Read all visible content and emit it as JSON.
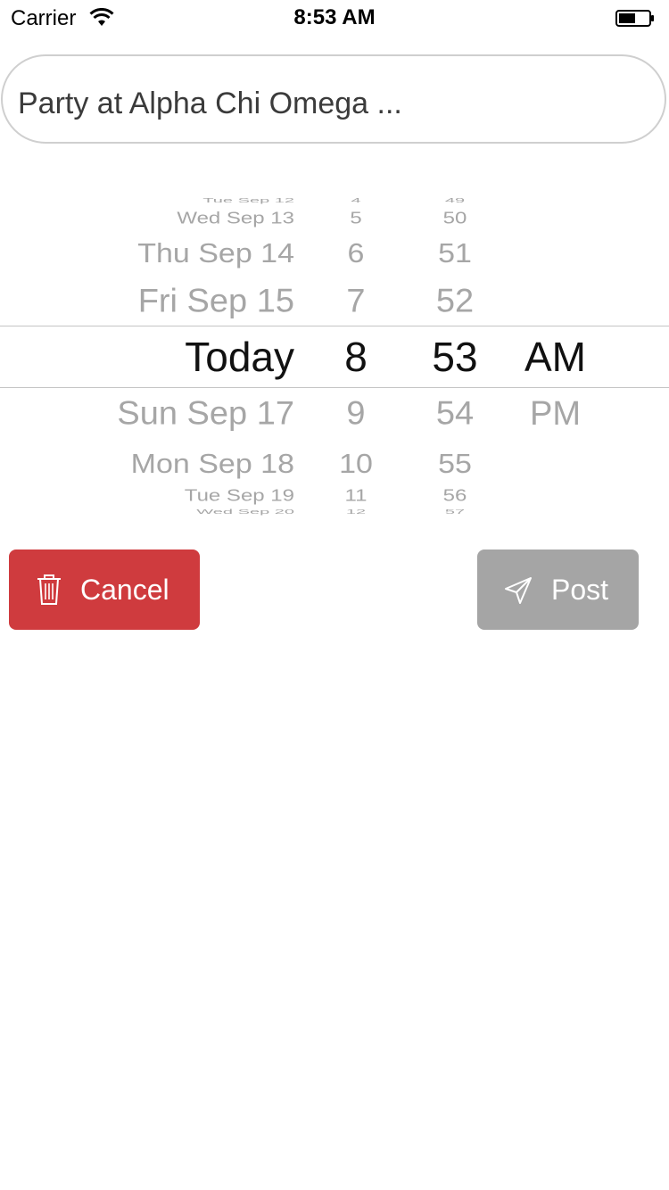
{
  "status_bar": {
    "carrier": "Carrier",
    "time": "8:53 AM"
  },
  "title_field": {
    "value": "Party at Alpha Chi Omega ..."
  },
  "date_picker": {
    "dates": [
      "Tue Sep 12",
      "Wed Sep 13",
      "Thu Sep 14",
      "Fri Sep 15",
      "Today",
      "Sun Sep 17",
      "Mon Sep 18",
      "Tue Sep 19",
      "Wed Sep 20"
    ],
    "hours": [
      "4",
      "5",
      "6",
      "7",
      "8",
      "9",
      "10",
      "11",
      "12"
    ],
    "minutes": [
      "49",
      "50",
      "51",
      "52",
      "53",
      "54",
      "55",
      "56",
      "57"
    ],
    "periods": [
      "AM",
      "PM"
    ],
    "selected": {
      "date": "Today",
      "hour": "8",
      "minute": "53",
      "period": "AM"
    }
  },
  "actions": {
    "cancel_label": "Cancel",
    "post_label": "Post"
  },
  "colors": {
    "cancel": "#cf3b3e",
    "post_disabled": "#a5a5a5",
    "picker_unselected": "#a6a6a6"
  },
  "icons": {
    "cancel": "trash-icon",
    "post": "send-icon",
    "status_wifi": "wifi-icon",
    "status_battery": "battery-icon"
  }
}
